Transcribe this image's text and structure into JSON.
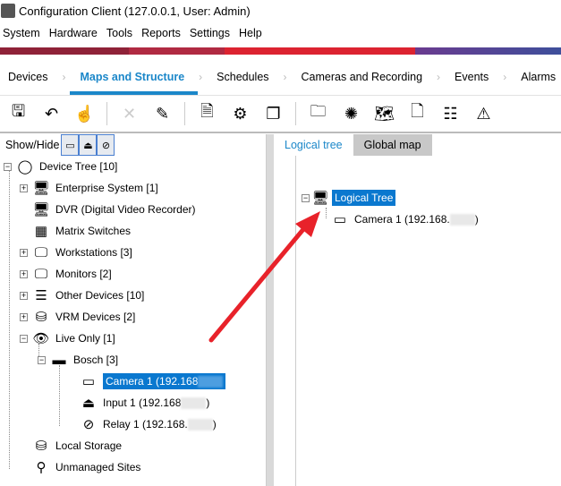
{
  "window": {
    "title": "Configuration Client (127.0.0.1, User: Admin)"
  },
  "menu": [
    "System",
    "Hardware",
    "Tools",
    "Reports",
    "Settings",
    "Help"
  ],
  "tabs": [
    {
      "label": "Devices"
    },
    {
      "label": "Maps and Structure",
      "active": true
    },
    {
      "label": "Schedules"
    },
    {
      "label": "Cameras and Recording"
    },
    {
      "label": "Events"
    },
    {
      "label": "Alarms"
    }
  ],
  "toolbar": [
    "save-icon",
    "undo-icon",
    "touch-icon",
    "delete-icon",
    "edit-icon",
    "edit-document-icon",
    "add-settings-icon",
    "add-group-icon",
    "add-folder-icon",
    "add-sequence-icon",
    "add-map-icon",
    "add-document-icon",
    "add-command-icon",
    "add-alarm-icon"
  ],
  "left": {
    "show_hide": "Show/Hide",
    "tree": [
      {
        "label": "Device Tree [10]",
        "icon": "◯"
      },
      {
        "label": "Enterprise System [1]",
        "icon": "🖥"
      },
      {
        "label": "DVR (Digital Video Recorder)",
        "icon": "🖥"
      },
      {
        "label": "Matrix Switches",
        "icon": "▦"
      },
      {
        "label": "Workstations [3]",
        "icon": "🖵"
      },
      {
        "label": "Monitors [2]",
        "icon": "🖵"
      },
      {
        "label": "Other Devices [10]",
        "icon": "☰"
      },
      {
        "label": "VRM Devices [2]",
        "icon": "⛁"
      },
      {
        "label": "Live Only [1]",
        "icon": "👁"
      },
      {
        "label": "Bosch [3]",
        "icon": "▬"
      },
      {
        "label": "Camera 1 (192.168",
        "icon": "▭"
      },
      {
        "label": "Input 1 (192.168",
        "icon": "⏏"
      },
      {
        "label": "Relay 1 (192.168.",
        "icon": "⊘"
      },
      {
        "label": "Local Storage",
        "icon": "⛁"
      },
      {
        "label": "Unmanaged Sites",
        "icon": "⚲"
      }
    ]
  },
  "right": {
    "tabs": [
      "Logical tree",
      "Global map"
    ],
    "root": "Logical Tree",
    "child": "Camera 1 (192.168."
  },
  "colors": {
    "accent": "#1b87c9",
    "arrow": "#e8222a"
  }
}
